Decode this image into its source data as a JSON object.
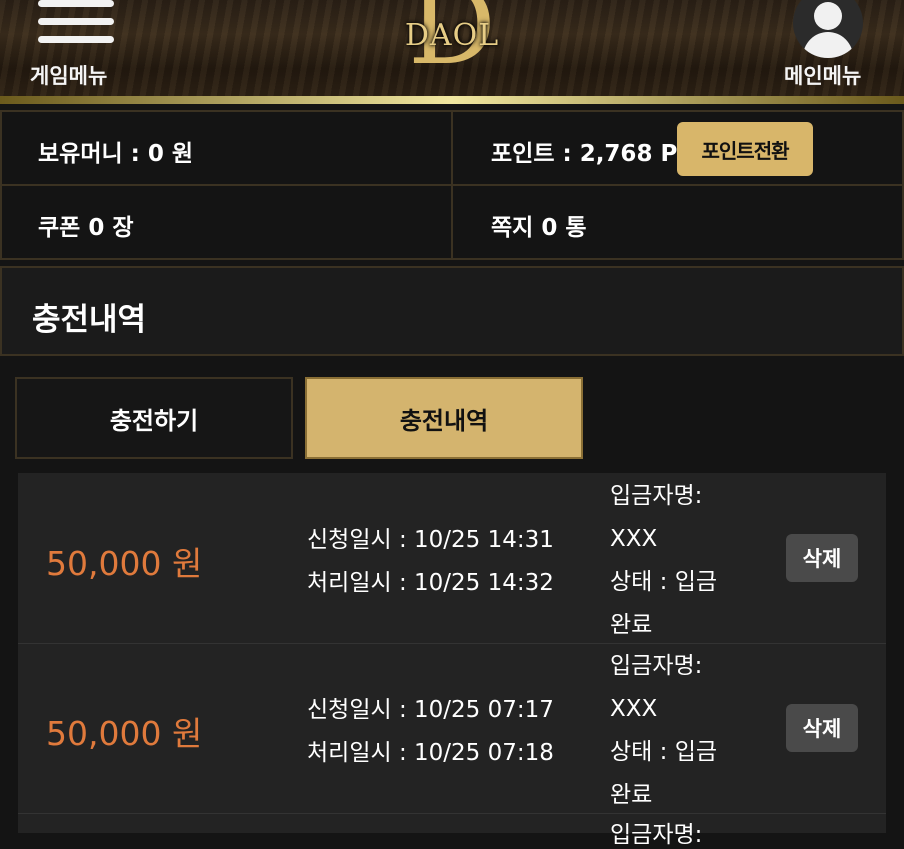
{
  "header": {
    "game_menu_label": "게임메뉴",
    "main_menu_label": "메인메뉴",
    "logo_letter": "D",
    "logo_text": "DAOL"
  },
  "info": {
    "money": "보유머니 : 0 원",
    "points": "포인트 : 2,768 P",
    "convert_button": "포인트전환",
    "coupons": "쿠폰 0 장",
    "messages": "쪽지 0 통"
  },
  "section_title": "충전내역",
  "tabs": [
    {
      "label": "충전하기",
      "active": false
    },
    {
      "label": "충전내역",
      "active": true
    }
  ],
  "history": [
    {
      "amount": "50,000 원",
      "requested": "신청일시 : 10/25 14:31",
      "processed": "처리일시 : 10/25 14:32",
      "depositor_label": "입금자명:",
      "depositor": "XXX",
      "status_label": "상태 : 입금",
      "status_value": "완료",
      "delete_label": "삭제"
    },
    {
      "amount": "50,000 원",
      "requested": "신청일시 : 10/25 07:17",
      "processed": "처리일시 : 10/25 07:18",
      "depositor_label": "입금자명:",
      "depositor": "XXX",
      "status_label": "상태 : 입금",
      "status_value": "완료",
      "delete_label": "삭제"
    }
  ],
  "next_row_peek": "입금자명:",
  "colors": {
    "accent_gold": "#d4b46e",
    "amount_orange": "#e07a3c"
  }
}
